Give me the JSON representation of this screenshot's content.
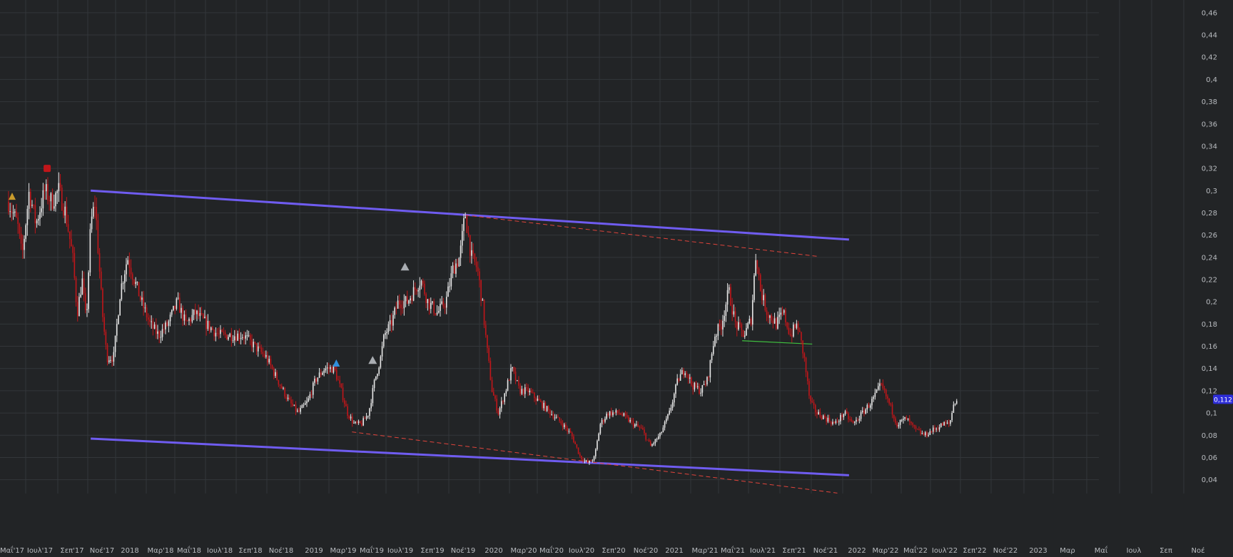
{
  "colors": {
    "background": "#222426",
    "grid": "#33363a",
    "axis_text": "#b9bcc0",
    "candle_up": "#e8e8e8",
    "candle_down": "#c0161a",
    "channel": "#6f5cf0",
    "trend_dashed": "#e0443c",
    "support": "#3fbf3f",
    "price_badge": "#2d2dd8",
    "marker_gray": "#a9adb2",
    "marker_red": "#c0161a",
    "marker_blue": "#2f8fdc",
    "marker_gold": "#c89b2c"
  },
  "chart_data": {
    "type": "candlestick",
    "title": "",
    "xlabel": "",
    "ylabel": "",
    "ylim": [
      0.03,
      0.47
    ],
    "y_axis_position": "right",
    "grid": true,
    "y_ticks": [
      "0,04",
      "0,06",
      "0,08",
      "0,1",
      "0,12",
      "0,14",
      "0,16",
      "0,18",
      "0,2",
      "0,22",
      "0,24",
      "0,26",
      "0,28",
      "0,3",
      "0,32",
      "0,34",
      "0,36",
      "0,38",
      "0,4",
      "0,42",
      "0,44",
      "0,46"
    ],
    "x_ticks": [
      "Μαΐ'17",
      "Ιουλ'17",
      "Σεπ'17",
      "Νοέ'17",
      "2018",
      "Μαρ'18",
      "Μαΐ'18",
      "Ιουλ'18",
      "Σεπ'18",
      "Νοέ'18",
      "2019",
      "Μαρ'19",
      "Μαΐ'19",
      "Ιουλ'19",
      "Σεπ'19",
      "Νοέ'19",
      "2020",
      "Μαρ'20",
      "Μαΐ'20",
      "Ιουλ'20",
      "Σεπ'20",
      "Νοέ'20",
      "2021",
      "Μαρ'21",
      "Μαΐ'21",
      "Ιουλ'21",
      "Σεπ'21",
      "Νοέ'21",
      "2022",
      "Μαρ'22",
      "Μαΐ'22",
      "Ιουλ'22",
      "Σεπ'22",
      "Νοέ'22",
      "2023",
      "Μαρ",
      "Μαΐ",
      "Ιουλ",
      "Σεπ",
      "Νοέ"
    ],
    "last_price": "0,112",
    "price_path": [
      [
        "2017-04-20",
        0.29
      ],
      [
        "2017-05-10",
        0.27
      ],
      [
        "2017-05-20",
        0.24
      ],
      [
        "2017-06-05",
        0.3
      ],
      [
        "2017-06-20",
        0.27
      ],
      [
        "2017-07-10",
        0.3
      ],
      [
        "2017-07-25",
        0.29
      ],
      [
        "2017-08-10",
        0.3
      ],
      [
        "2017-08-25",
        0.28
      ],
      [
        "2017-09-10",
        0.24
      ],
      [
        "2017-09-20",
        0.19
      ],
      [
        "2017-10-01",
        0.22
      ],
      [
        "2017-10-10",
        0.18
      ],
      [
        "2017-10-20",
        0.27
      ],
      [
        "2017-10-30",
        0.29
      ],
      [
        "2017-11-05",
        0.25
      ],
      [
        "2017-11-15",
        0.19
      ],
      [
        "2017-11-25",
        0.15
      ],
      [
        "2017-12-10",
        0.15
      ],
      [
        "2017-12-25",
        0.21
      ],
      [
        "2018-01-10",
        0.24
      ],
      [
        "2018-01-25",
        0.22
      ],
      [
        "2018-02-10",
        0.2
      ],
      [
        "2018-03-01",
        0.18
      ],
      [
        "2018-03-20",
        0.17
      ],
      [
        "2018-04-10",
        0.18
      ],
      [
        "2018-05-01",
        0.2
      ],
      [
        "2018-05-20",
        0.18
      ],
      [
        "2018-06-10",
        0.19
      ],
      [
        "2018-07-05",
        0.18
      ],
      [
        "2018-08-01",
        0.17
      ],
      [
        "2018-09-01",
        0.17
      ],
      [
        "2018-09-25",
        0.17
      ],
      [
        "2018-10-20",
        0.16
      ],
      [
        "2018-11-15",
        0.15
      ],
      [
        "2018-12-10",
        0.13
      ],
      [
        "2019-01-05",
        0.11
      ],
      [
        "2019-01-25",
        0.1
      ],
      [
        "2019-02-15",
        0.11
      ],
      [
        "2019-03-05",
        0.13
      ],
      [
        "2019-03-25",
        0.14
      ],
      [
        "2019-04-15",
        0.14
      ],
      [
        "2019-05-01",
        0.12
      ],
      [
        "2019-05-15",
        0.1
      ],
      [
        "2019-05-30",
        0.09
      ],
      [
        "2019-06-15",
        0.09
      ],
      [
        "2019-07-01",
        0.1
      ],
      [
        "2019-07-15",
        0.13
      ],
      [
        "2019-07-28",
        0.15
      ],
      [
        "2019-08-05",
        0.17
      ],
      [
        "2019-08-20",
        0.18
      ],
      [
        "2019-09-05",
        0.2
      ],
      [
        "2019-09-25",
        0.2
      ],
      [
        "2019-10-10",
        0.21
      ],
      [
        "2019-10-25",
        0.22
      ],
      [
        "2019-11-10",
        0.2
      ],
      [
        "2019-12-01",
        0.19
      ],
      [
        "2019-12-20",
        0.2
      ],
      [
        "2020-01-05",
        0.23
      ],
      [
        "2020-01-20",
        0.24
      ],
      [
        "2020-02-01",
        0.28
      ],
      [
        "2020-02-15",
        0.24
      ],
      [
        "2020-02-28",
        0.23
      ],
      [
        "2020-03-10",
        0.2
      ],
      [
        "2020-03-20",
        0.16
      ],
      [
        "2020-04-01",
        0.12
      ],
      [
        "2020-04-15",
        0.1
      ],
      [
        "2020-05-01",
        0.12
      ],
      [
        "2020-05-15",
        0.14
      ],
      [
        "2020-06-01",
        0.12
      ],
      [
        "2020-06-20",
        0.12
      ],
      [
        "2020-07-15",
        0.11
      ],
      [
        "2020-08-10",
        0.1
      ],
      [
        "2020-09-05",
        0.09
      ],
      [
        "2020-09-25",
        0.08
      ],
      [
        "2020-10-15",
        0.06
      ],
      [
        "2020-11-01",
        0.055
      ],
      [
        "2020-11-15",
        0.06
      ],
      [
        "2020-11-28",
        0.09
      ],
      [
        "2020-12-15",
        0.1
      ],
      [
        "2021-01-10",
        0.1
      ],
      [
        "2021-02-10",
        0.09
      ],
      [
        "2021-03-01",
        0.085
      ],
      [
        "2021-03-20",
        0.07
      ],
      [
        "2021-04-10",
        0.08
      ],
      [
        "2021-05-01",
        0.1
      ],
      [
        "2021-05-20",
        0.13
      ],
      [
        "2021-06-05",
        0.14
      ],
      [
        "2021-06-20",
        0.125
      ],
      [
        "2021-07-10",
        0.12
      ],
      [
        "2021-07-25",
        0.13
      ],
      [
        "2021-08-10",
        0.17
      ],
      [
        "2021-08-25",
        0.18
      ],
      [
        "2021-09-10",
        0.21
      ],
      [
        "2021-09-25",
        0.18
      ],
      [
        "2021-10-15",
        0.17
      ],
      [
        "2021-10-30",
        0.185
      ],
      [
        "2021-11-10",
        0.245
      ],
      [
        "2021-11-20",
        0.21
      ],
      [
        "2021-12-05",
        0.19
      ],
      [
        "2021-12-25",
        0.18
      ],
      [
        "2022-01-10",
        0.19
      ],
      [
        "2022-01-25",
        0.17
      ],
      [
        "2022-02-10",
        0.18
      ],
      [
        "2022-02-25",
        0.15
      ],
      [
        "2022-03-10",
        0.11
      ],
      [
        "2022-03-25",
        0.1
      ],
      [
        "2022-04-15",
        0.095
      ],
      [
        "2022-05-05",
        0.09
      ],
      [
        "2022-05-25",
        0.1
      ],
      [
        "2022-06-15",
        0.09
      ],
      [
        "2022-07-05",
        0.1
      ],
      [
        "2022-07-25",
        0.11
      ],
      [
        "2022-08-15",
        0.125
      ],
      [
        "2022-09-01",
        0.11
      ],
      [
        "2022-09-20",
        0.09
      ],
      [
        "2022-10-10",
        0.095
      ],
      [
        "2022-10-30",
        0.085
      ],
      [
        "2022-11-20",
        0.08
      ],
      [
        "2022-12-10",
        0.085
      ],
      [
        "2023-01-01",
        0.09
      ],
      [
        "2023-01-15",
        0.09
      ],
      [
        "2023-01-25",
        0.11
      ],
      [
        "2023-02-01",
        0.112
      ]
    ],
    "lines": [
      {
        "kind": "channel-upper",
        "style": "solid",
        "from": [
          "2017-10-20",
          0.3
        ],
        "to": [
          "2022-06-05",
          0.256
        ]
      },
      {
        "kind": "channel-lower",
        "style": "solid",
        "from": [
          "2017-10-20",
          0.077
        ],
        "to": [
          "2022-06-05",
          0.044
        ]
      },
      {
        "kind": "trend-upper",
        "style": "dashed",
        "from": [
          "2020-02-01",
          0.278
        ],
        "to": [
          "2022-03-25",
          0.241
        ]
      },
      {
        "kind": "trend-lower",
        "style": "dashed",
        "from": [
          "2019-05-25",
          0.083
        ],
        "to": [
          "2022-05-10",
          0.028
        ]
      },
      {
        "kind": "support",
        "style": "solid",
        "from": [
          "2021-10-10",
          0.165
        ],
        "to": [
          "2022-03-15",
          0.162
        ]
      }
    ],
    "markers": [
      {
        "kind": "gold",
        "date": "2017-04-28",
        "value": 0.295
      },
      {
        "kind": "red-square",
        "date": "2017-07-15",
        "value": 0.32
      },
      {
        "kind": "gray-triangle",
        "date": "2019-09-20",
        "value": 0.232
      },
      {
        "kind": "gray-triangle",
        "date": "2019-07-10",
        "value": 0.148
      },
      {
        "kind": "blue",
        "date": "2019-04-20",
        "value": 0.145
      }
    ]
  }
}
